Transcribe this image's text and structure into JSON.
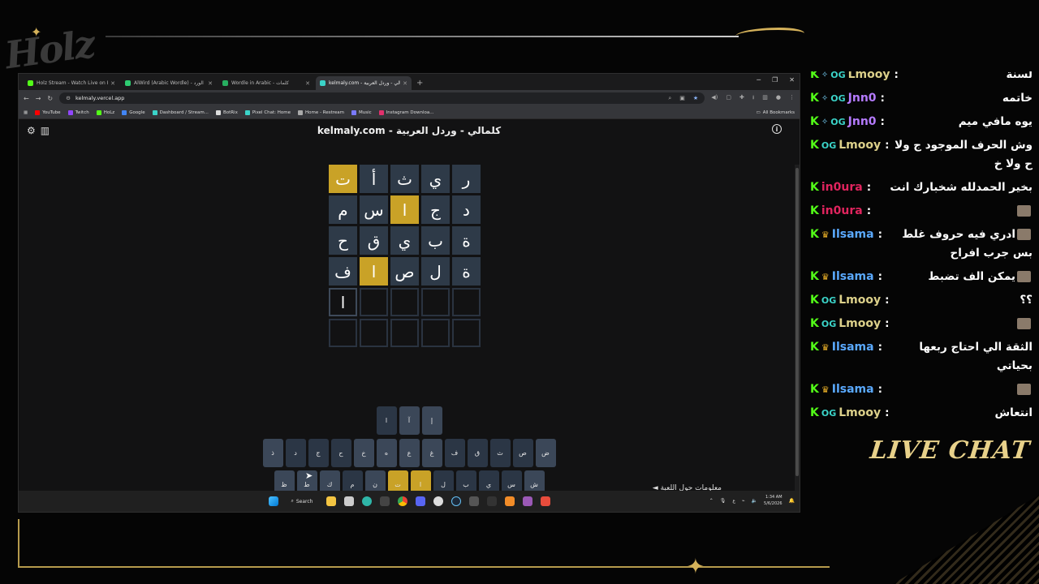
{
  "browser": {
    "tabs": [
      {
        "label": "Holz Stream - Watch Live on Ki",
        "color": "#53fc18",
        "active": false
      },
      {
        "label": "AlWird (Arabic Wordle) - الورد",
        "color": "#2ecc71",
        "active": false
      },
      {
        "label": "Wordle in Arabic - كلمات",
        "color": "#27ae60",
        "active": false
      },
      {
        "label": "kelmaly.com - كلمالي - وردل العربية",
        "color": "#3bd4c9",
        "active": true
      }
    ],
    "url": "kelmaly.vercel.app",
    "bookmarks": [
      {
        "label": "YouTube",
        "color": "#ff0000"
      },
      {
        "label": "Twitch",
        "color": "#9146ff"
      },
      {
        "label": "HoLz",
        "color": "#53fc18"
      },
      {
        "label": "Google",
        "color": "#4285f4"
      },
      {
        "label": "Dashboard / Stream...",
        "color": "#3bd4c9"
      },
      {
        "label": "BotRix",
        "color": "#dddddd"
      },
      {
        "label": "Pixel Chat: Home",
        "color": "#3bd4c9"
      },
      {
        "label": "Home - Restream",
        "color": "#aaaaaa"
      },
      {
        "label": "Music",
        "color": "#7a7aff"
      },
      {
        "label": "Instagram Downloa...",
        "color": "#e1306c"
      }
    ],
    "all_bookmarks": "All Bookmarks"
  },
  "page": {
    "title": "kelmaly.com - كلمالي - وردل العربية",
    "info_link": "معلومات حول اللعبة ◄",
    "grid": [
      [
        {
          "l": "ر",
          "s": "absent"
        },
        {
          "l": "ي",
          "s": "absent"
        },
        {
          "l": "ث",
          "s": "absent"
        },
        {
          "l": "أ",
          "s": "absent"
        },
        {
          "l": "ت",
          "s": "present"
        }
      ],
      [
        {
          "l": "د",
          "s": "absent"
        },
        {
          "l": "ج",
          "s": "absent"
        },
        {
          "l": "ا",
          "s": "present"
        },
        {
          "l": "س",
          "s": "absent"
        },
        {
          "l": "م",
          "s": "absent"
        }
      ],
      [
        {
          "l": "ة",
          "s": "absent"
        },
        {
          "l": "ب",
          "s": "absent"
        },
        {
          "l": "ي",
          "s": "absent"
        },
        {
          "l": "ق",
          "s": "absent"
        },
        {
          "l": "ح",
          "s": "absent"
        }
      ],
      [
        {
          "l": "ة",
          "s": "absent"
        },
        {
          "l": "ل",
          "s": "absent"
        },
        {
          "l": "ص",
          "s": "absent"
        },
        {
          "l": "ا",
          "s": "present"
        },
        {
          "l": "ف",
          "s": "absent"
        }
      ],
      [
        {
          "l": "",
          "s": "empty"
        },
        {
          "l": "",
          "s": "empty"
        },
        {
          "l": "",
          "s": "empty"
        },
        {
          "l": "",
          "s": "empty"
        },
        {
          "l": "ا",
          "s": "typed"
        }
      ],
      [
        {
          "l": "",
          "s": "empty"
        },
        {
          "l": "",
          "s": "empty"
        },
        {
          "l": "",
          "s": "empty"
        },
        {
          "l": "",
          "s": "empty"
        },
        {
          "l": "",
          "s": "empty"
        }
      ]
    ],
    "keyboard": [
      [
        {
          "k": "إ",
          "s": "unused"
        },
        {
          "k": "آ",
          "s": "unused"
        },
        {
          "k": "ا",
          "s": "absent"
        }
      ],
      [
        {
          "k": "ض",
          "s": "unused"
        },
        {
          "k": "ص",
          "s": "absent"
        },
        {
          "k": "ث",
          "s": "absent"
        },
        {
          "k": "ق",
          "s": "absent"
        },
        {
          "k": "ف",
          "s": "absent"
        },
        {
          "k": "غ",
          "s": "unused"
        },
        {
          "k": "ع",
          "s": "unused"
        },
        {
          "k": "ه",
          "s": "unused"
        },
        {
          "k": "خ",
          "s": "unused"
        },
        {
          "k": "ح",
          "s": "absent"
        },
        {
          "k": "ج",
          "s": "absent"
        },
        {
          "k": "د",
          "s": "absent"
        },
        {
          "k": "ذ",
          "s": "unused"
        }
      ],
      [
        {
          "k": "ش",
          "s": "unused"
        },
        {
          "k": "س",
          "s": "absent"
        },
        {
          "k": "ي",
          "s": "absent"
        },
        {
          "k": "ب",
          "s": "absent"
        },
        {
          "k": "ل",
          "s": "absent"
        },
        {
          "k": "ا",
          "s": "present"
        },
        {
          "k": "ت",
          "s": "present"
        },
        {
          "k": "ن",
          "s": "unused"
        },
        {
          "k": "م",
          "s": "absent"
        },
        {
          "k": "ك",
          "s": "unused"
        },
        {
          "k": "ط",
          "s": "unused"
        },
        {
          "k": "ظ",
          "s": "unused"
        }
      ],
      [
        {
          "k": "Delete",
          "s": "unused",
          "wide": true
        },
        {
          "k": "ئ",
          "s": "unused"
        },
        {
          "k": "ء",
          "s": "unused"
        },
        {
          "k": "ؤ",
          "s": "unused"
        },
        {
          "k": "ر",
          "s": "absent"
        },
        {
          "k": "ى",
          "s": "unused"
        },
        {
          "k": "ة",
          "s": "absent"
        },
        {
          "k": "و",
          "s": "unused"
        },
        {
          "k": "ز",
          "s": "unused"
        },
        {
          "k": "Enter",
          "s": "unused",
          "wide": true
        }
      ]
    ]
  },
  "taskbar": {
    "search_label": "Search",
    "time": "1:34 AM",
    "date": "5/6/2026",
    "lang": "ع"
  },
  "chat": {
    "title": "LIVE CHAT",
    "messages": [
      {
        "user": "Lmooy",
        "color": "#dcd08a",
        "badges": [
          "k",
          "mic",
          "og"
        ],
        "text": "لسنة"
      },
      {
        "user": "Jnn0",
        "color": "#b57bff",
        "badges": [
          "k",
          "mic",
          "og"
        ],
        "text": "خاتمه"
      },
      {
        "user": "Jnn0",
        "color": "#b57bff",
        "badges": [
          "k",
          "mic",
          "og"
        ],
        "text": "يوه مافي ميم"
      },
      {
        "user": "Lmooy",
        "color": "#dcd08a",
        "badges": [
          "k",
          "og"
        ],
        "text": "وش الحرف الموجود ج ولا ح ولا خ"
      },
      {
        "user": "in0ura",
        "color": "#e0245e",
        "badges": [
          "k"
        ],
        "text": "بخير الحمدلله شخبارك انت"
      },
      {
        "user": "in0ura",
        "color": "#e0245e",
        "badges": [
          "k"
        ],
        "text": "",
        "emote": true
      },
      {
        "user": "Ilsama",
        "color": "#5aa9ff",
        "badges": [
          "k",
          "crown"
        ],
        "text": "ادري فيه حروف غلط بس جرب افراح",
        "emote": true
      },
      {
        "user": "Ilsama",
        "color": "#5aa9ff",
        "badges": [
          "k",
          "crown"
        ],
        "text": "يمكن الف تضبط",
        "emote": true
      },
      {
        "user": "Lmooy",
        "color": "#dcd08a",
        "badges": [
          "k",
          "og"
        ],
        "text": "؟؟"
      },
      {
        "user": "Lmooy",
        "color": "#dcd08a",
        "badges": [
          "k",
          "og"
        ],
        "text": "",
        "emote": true
      },
      {
        "user": "Ilsama",
        "color": "#5aa9ff",
        "badges": [
          "k",
          "crown"
        ],
        "text": "الثقة الي احتاج ربعها بحياتي"
      },
      {
        "user": "Ilsama",
        "color": "#5aa9ff",
        "badges": [
          "k",
          "crown"
        ],
        "text": "",
        "emote": true
      },
      {
        "user": "Lmooy",
        "color": "#dcd08a",
        "badges": [
          "k",
          "og"
        ],
        "text": "انتعاش"
      }
    ]
  },
  "overlay": {
    "logo": "Holz"
  },
  "icons": [
    "settings-icon",
    "stats-icon",
    "info-icon",
    "windows-start-icon",
    "search-icon"
  ]
}
